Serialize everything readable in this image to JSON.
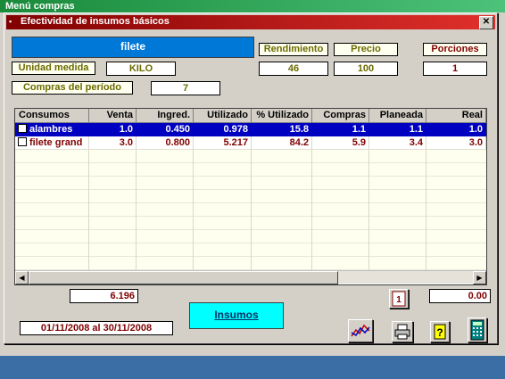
{
  "parent_window": {
    "title": "Menú compras"
  },
  "dialog": {
    "title": "Efectividad de insumos básicos",
    "close_label": "✕"
  },
  "product_name": "filete",
  "headers": {
    "rendimiento": "Rendimiento",
    "precio": "Precio",
    "porciones": "Porciones"
  },
  "values": {
    "rendimiento": "46",
    "precio": "100",
    "porciones": "1"
  },
  "unidad_medida": {
    "label": "Unidad medida",
    "value": "KILO"
  },
  "compras_periodo": {
    "label": "Compras del período",
    "value": "7"
  },
  "grid": {
    "columns": [
      "Consumos",
      "Venta",
      "Ingred.",
      "Utilizado",
      "% Utilizado",
      "Compras",
      "Planeada",
      "Real"
    ],
    "rows": [
      {
        "name": "alambres",
        "venta": "1.0",
        "ingred": "0.450",
        "utilizado": "0.978",
        "pct": "15.8",
        "compras": "1.1",
        "planeada": "1.1",
        "real": "1.0",
        "selected": true
      },
      {
        "name": "filete grand",
        "venta": "3.0",
        "ingred": "0.800",
        "utilizado": "5.217",
        "pct": "84.2",
        "compras": "5.9",
        "planeada": "3.4",
        "real": "3.0",
        "selected": false
      }
    ]
  },
  "totals": {
    "left": "6.196",
    "right": "0.00"
  },
  "period": "01/11/2008  al  30/11/2008",
  "insumos_button": "Insumos",
  "colors": {
    "title_gradient": [
      "#800000",
      "#e0302c"
    ],
    "selected_row": "#0000c0",
    "product_bg": "#0078d7",
    "insumos_bg": "#00ffff"
  },
  "icons": [
    "chart-icon",
    "printer-icon",
    "help-icon",
    "calculator-icon",
    "excel-icon"
  ]
}
